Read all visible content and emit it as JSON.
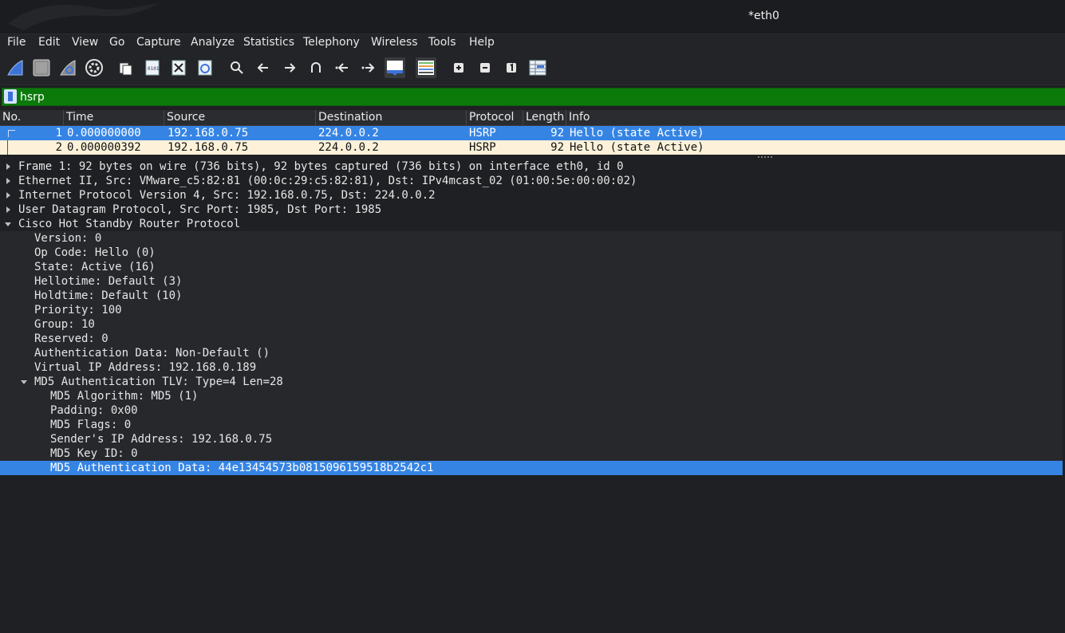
{
  "window": {
    "title": "*eth0"
  },
  "menu": [
    "File",
    "Edit",
    "View",
    "Go",
    "Capture",
    "Analyze",
    "Statistics",
    "Telephony",
    "Wireless",
    "Tools",
    "Help"
  ],
  "toolbar": {
    "icons": [
      "shark-start-icon",
      "stop-icon",
      "shark-restart-icon",
      "capture-options-gear-icon",
      "open-file-icon",
      "save-file-icon",
      "close-file-icon",
      "reload-icon",
      "find-packet-icon",
      "go-back-icon",
      "go-forward-icon",
      "go-to-packet-icon",
      "first-packet-icon",
      "last-packet-icon",
      "autoscroll-icon",
      "colorize-icon",
      "zoom-in-icon",
      "zoom-out-icon",
      "normal-size-icon",
      "resize-columns-icon"
    ]
  },
  "filter": {
    "value": "hsrp"
  },
  "packet_list": {
    "columns": [
      "No.",
      "Time",
      "Source",
      "Destination",
      "Protocol",
      "Length",
      "Info"
    ],
    "rows": [
      {
        "no": "1",
        "time": "0.000000000",
        "source": "192.168.0.75",
        "destination": "224.0.0.2",
        "protocol": "HSRP",
        "length": "92",
        "info": "Hello (state Active)"
      },
      {
        "no": "2",
        "time": "0.000000392",
        "source": "192.168.0.75",
        "destination": "224.0.0.2",
        "protocol": "HSRP",
        "length": "92",
        "info": "Hello (state Active)"
      }
    ]
  },
  "details": [
    {
      "text": "Frame 1: 92 bytes on wire (736 bits), 92 bytes captured (736 bits) on interface eth0, id 0",
      "level": 0,
      "arrow": "right"
    },
    {
      "text": "Ethernet II, Src: VMware_c5:82:81 (00:0c:29:c5:82:81), Dst: IPv4mcast_02 (01:00:5e:00:00:02)",
      "level": 0,
      "arrow": "right"
    },
    {
      "text": "Internet Protocol Version 4, Src: 192.168.0.75, Dst: 224.0.0.2",
      "level": 0,
      "arrow": "right"
    },
    {
      "text": "User Datagram Protocol, Src Port: 1985, Dst Port: 1985",
      "level": 0,
      "arrow": "right"
    },
    {
      "text": "Cisco Hot Standby Router Protocol",
      "level": 0,
      "arrow": "down"
    },
    {
      "text": "Version: 0",
      "level": 1
    },
    {
      "text": "Op Code: Hello (0)",
      "level": 1
    },
    {
      "text": "State: Active (16)",
      "level": 1
    },
    {
      "text": "Hellotime: Default (3)",
      "level": 1
    },
    {
      "text": "Holdtime: Default (10)",
      "level": 1
    },
    {
      "text": "Priority: 100",
      "level": 1
    },
    {
      "text": "Group: 10",
      "level": 1
    },
    {
      "text": "Reserved: 0",
      "level": 1
    },
    {
      "text": "Authentication Data: Non-Default ()",
      "level": 1
    },
    {
      "text": "Virtual IP Address: 192.168.0.189",
      "level": 1
    },
    {
      "text": "MD5 Authentication TLV: Type=4 Len=28",
      "level": 1,
      "arrow": "down"
    },
    {
      "text": "MD5 Algorithm: MD5 (1)",
      "level": 2
    },
    {
      "text": "Padding: 0x00",
      "level": 2
    },
    {
      "text": "MD5 Flags: 0",
      "level": 2
    },
    {
      "text": "Sender's IP Address: 192.168.0.75",
      "level": 2
    },
    {
      "text": "MD5 Key ID: 0",
      "level": 2
    },
    {
      "text": "MD5 Authentication Data: 44e13454573b0815096159518b2542c1",
      "level": 2,
      "selected": true
    }
  ]
}
